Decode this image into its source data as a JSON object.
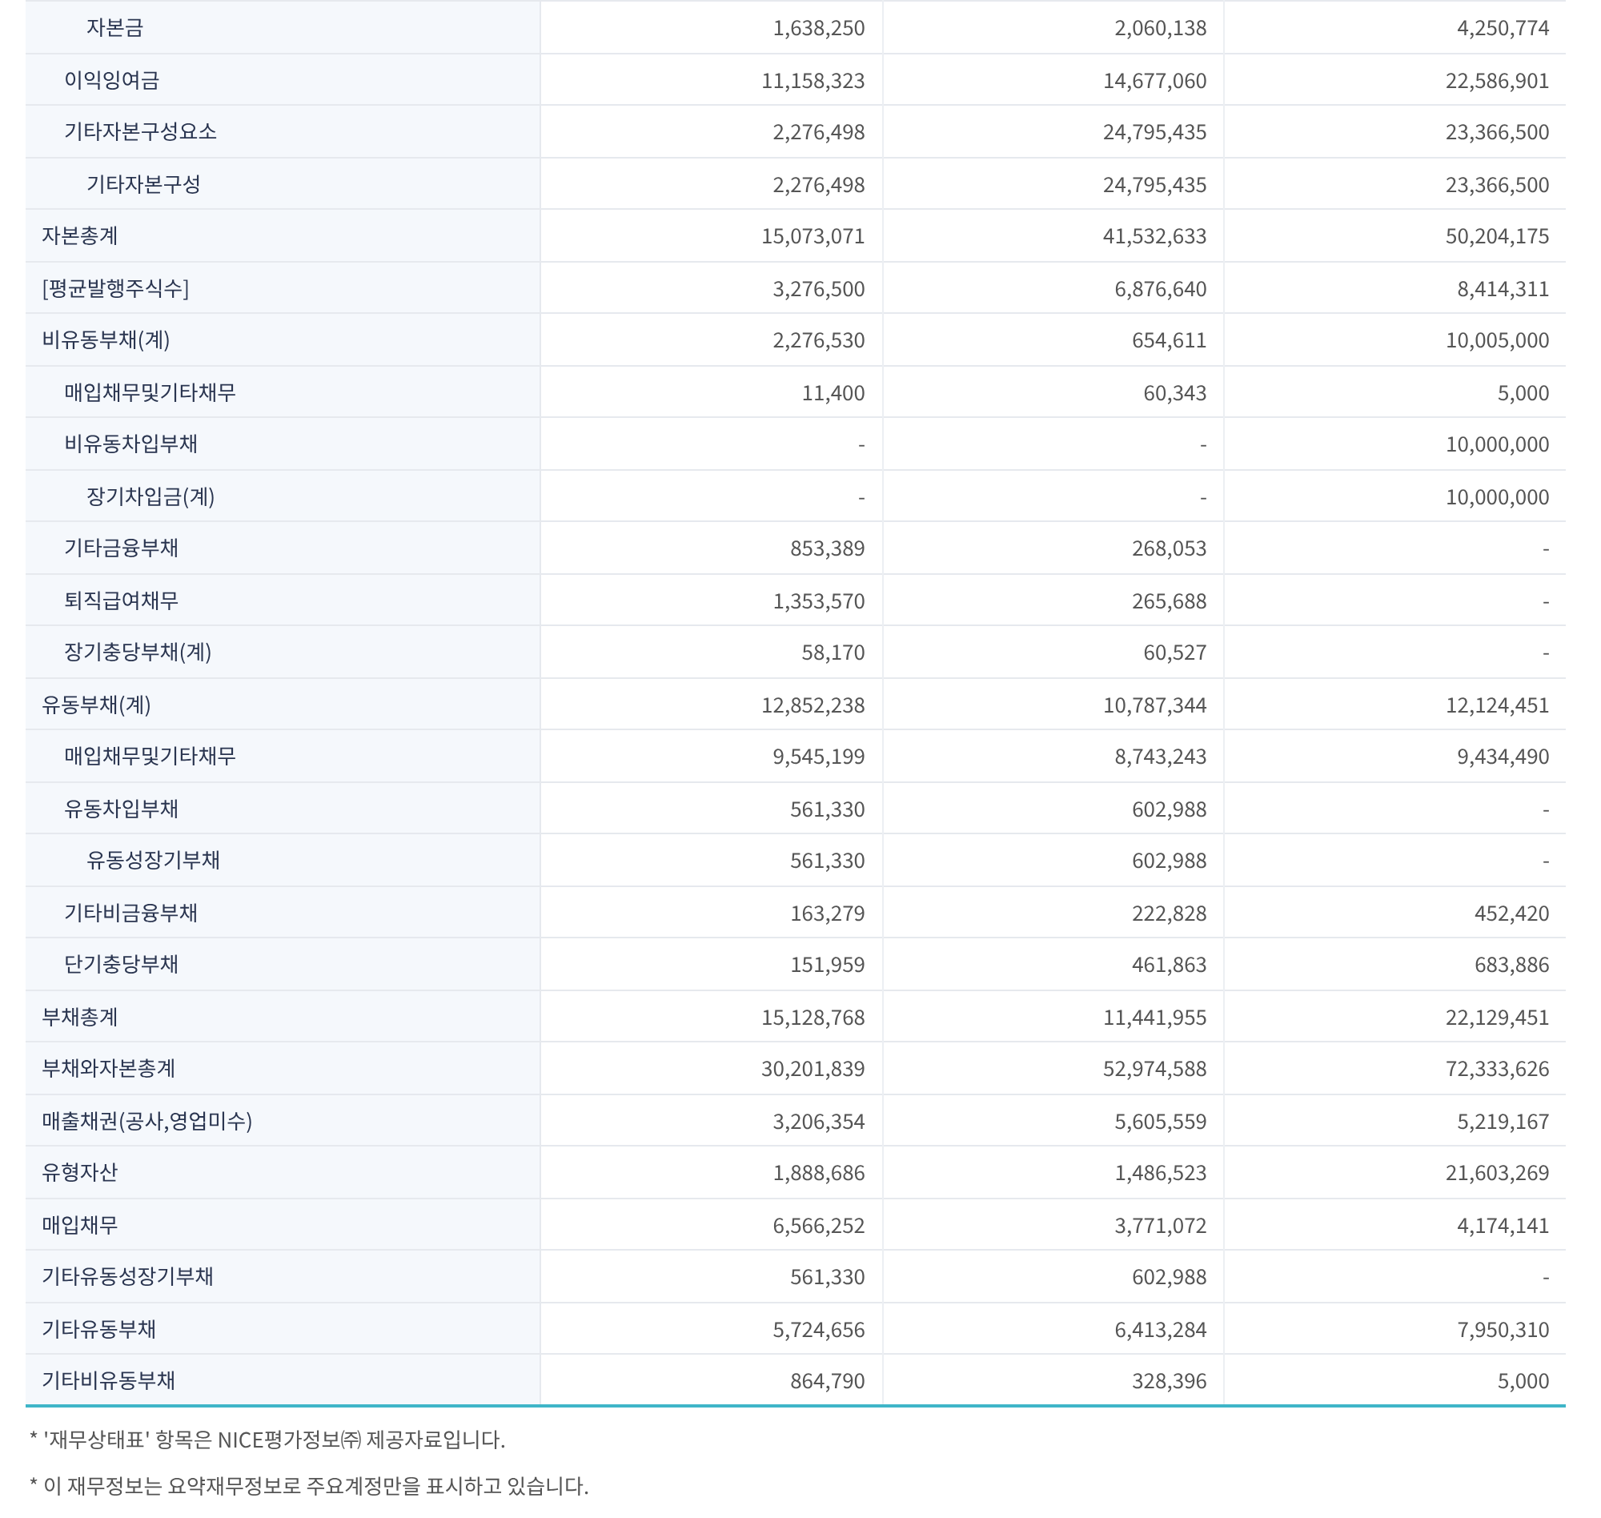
{
  "table": {
    "rows": [
      {
        "children": [
          {
            "children": [
              {
                "label": "자본금",
                "values": [
                  "1,638,250",
                  "2,060,138",
                  "4,250,774"
                ]
              }
            ]
          },
          {
            "label": "이익잉여금",
            "values": [
              "11,158,323",
              "14,677,060",
              "22,586,901"
            ]
          },
          {
            "label": "기타자본구성요소",
            "values": [
              "2,276,498",
              "24,795,435",
              "23,366,500"
            ],
            "children": [
              {
                "label": "기타자본구성",
                "values": [
                  "2,276,498",
                  "24,795,435",
                  "23,366,500"
                ]
              }
            ]
          }
        ]
      },
      {
        "label": "자본총계",
        "values": [
          "15,073,071",
          "41,532,633",
          "50,204,175"
        ]
      },
      {
        "label": "[평균발행주식수]",
        "values": [
          "3,276,500",
          "6,876,640",
          "8,414,311"
        ]
      },
      {
        "label": "비유동부채(계)",
        "values": [
          "2,276,530",
          "654,611",
          "10,005,000"
        ],
        "children": [
          {
            "label": "매입채무및기타채무",
            "values": [
              "11,400",
              "60,343",
              "5,000"
            ]
          },
          {
            "label": "비유동차입부채",
            "values": [
              "-",
              "-",
              "10,000,000"
            ],
            "children": [
              {
                "label": "장기차입금(계)",
                "values": [
                  "-",
                  "-",
                  "10,000,000"
                ]
              }
            ]
          },
          {
            "label": "기타금융부채",
            "values": [
              "853,389",
              "268,053",
              "-"
            ]
          },
          {
            "label": "퇴직급여채무",
            "values": [
              "1,353,570",
              "265,688",
              "-"
            ]
          },
          {
            "label": "장기충당부채(계)",
            "values": [
              "58,170",
              "60,527",
              "-"
            ]
          }
        ]
      },
      {
        "label": "유동부채(계)",
        "values": [
          "12,852,238",
          "10,787,344",
          "12,124,451"
        ],
        "children": [
          {
            "label": "매입채무및기타채무",
            "values": [
              "9,545,199",
              "8,743,243",
              "9,434,490"
            ]
          },
          {
            "label": "유동차입부채",
            "values": [
              "561,330",
              "602,988",
              "-"
            ],
            "children": [
              {
                "label": "유동성장기부채",
                "values": [
                  "561,330",
                  "602,988",
                  "-"
                ]
              }
            ]
          },
          {
            "label": "기타비금융부채",
            "values": [
              "163,279",
              "222,828",
              "452,420"
            ]
          },
          {
            "label": "단기충당부채",
            "values": [
              "151,959",
              "461,863",
              "683,886"
            ]
          }
        ]
      },
      {
        "label": "부채총계",
        "values": [
          "15,128,768",
          "11,441,955",
          "22,129,451"
        ]
      },
      {
        "label": "부채와자본총계",
        "values": [
          "30,201,839",
          "52,974,588",
          "72,333,626"
        ]
      },
      {
        "label": "매출채권(공사,영업미수)",
        "values": [
          "3,206,354",
          "5,605,559",
          "5,219,167"
        ]
      },
      {
        "label": "유형자산",
        "values": [
          "1,888,686",
          "1,486,523",
          "21,603,269"
        ]
      },
      {
        "label": "매입채무",
        "values": [
          "6,566,252",
          "3,771,072",
          "4,174,141"
        ]
      },
      {
        "label": "기타유동성장기부채",
        "values": [
          "561,330",
          "602,988",
          "-"
        ]
      },
      {
        "label": "기타유동부채",
        "values": [
          "5,724,656",
          "6,413,284",
          "7,950,310"
        ]
      },
      {
        "label": "기타비유동부채",
        "values": [
          "864,790",
          "328,396",
          "5,000"
        ]
      }
    ]
  },
  "notes": [
    "* '재무상태표' 항목은 NICE평가정보㈜ 제공자료입니다.",
    "* 이 재무정보는 요약재무정보로 주요계정만을 표시하고 있습니다."
  ]
}
